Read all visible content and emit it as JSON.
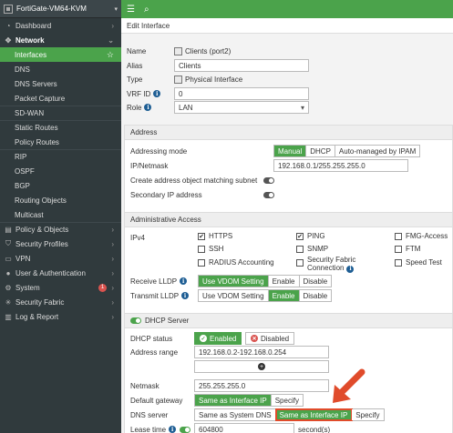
{
  "header": {
    "device_title": "FortiGate-VM64-KVM"
  },
  "sidebar": {
    "items": [
      {
        "label": "Dashboard",
        "icon": "dashboard-icon"
      },
      {
        "label": "Network",
        "icon": "network-icon"
      },
      {
        "label": "Interfaces"
      },
      {
        "label": "DNS"
      },
      {
        "label": "DNS Servers"
      },
      {
        "label": "Packet Capture"
      },
      {
        "label": "SD-WAN"
      },
      {
        "label": "Static Routes"
      },
      {
        "label": "Policy Routes"
      },
      {
        "label": "RIP"
      },
      {
        "label": "OSPF"
      },
      {
        "label": "BGP"
      },
      {
        "label": "Routing Objects"
      },
      {
        "label": "Multicast"
      },
      {
        "label": "Policy & Objects",
        "icon": "policy-icon"
      },
      {
        "label": "Security Profiles",
        "icon": "shield-icon"
      },
      {
        "label": "VPN",
        "icon": "vpn-icon"
      },
      {
        "label": "User & Authentication",
        "icon": "user-icon"
      },
      {
        "label": "System",
        "icon": "gear-icon",
        "badge": "1"
      },
      {
        "label": "Security Fabric",
        "icon": "fabric-icon"
      },
      {
        "label": "Log & Report",
        "icon": "chart-icon"
      }
    ]
  },
  "page": {
    "title": "Edit Interface"
  },
  "form": {
    "name_label": "Name",
    "name_value": "Clients (port2)",
    "alias_label": "Alias",
    "alias_value": "Clients",
    "type_label": "Type",
    "type_value": "Physical Interface",
    "vrf_label": "VRF ID",
    "vrf_value": "0",
    "role_label": "Role",
    "role_value": "LAN"
  },
  "address": {
    "header": "Address",
    "mode_label": "Addressing mode",
    "mode_options": [
      "Manual",
      "DHCP",
      "Auto-managed by IPAM"
    ],
    "ip_label": "IP/Netmask",
    "ip_value": "192.168.0.1/255.255.255.0",
    "create_obj_label": "Create address object matching subnet",
    "secondary_label": "Secondary IP address"
  },
  "admin": {
    "header": "Administrative Access",
    "ipv4_label": "IPv4",
    "https": "HTTPS",
    "ping": "PING",
    "fmg": "FMG-Access",
    "ssh": "SSH",
    "snmp": "SNMP",
    "ftm": "FTM",
    "radius": "RADIUS Accounting",
    "fabric_line1": "Security Fabric",
    "fabric_line2": "Connection",
    "speed": "Speed Test",
    "recv_lldp_label": "Receive LLDP",
    "trans_lldp_label": "Transmit LLDP",
    "lldp_options": [
      "Use VDOM Setting",
      "Enable",
      "Disable"
    ]
  },
  "dhcp": {
    "header": "DHCP Server",
    "status_label": "DHCP status",
    "enabled": "Enabled",
    "disabled": "Disabled",
    "range_label": "Address range",
    "range_value": "192.168.0.2-192.168.0.254",
    "netmask_label": "Netmask",
    "netmask_value": "255.255.255.0",
    "gateway_label": "Default gateway",
    "gateway_options": [
      "Same as Interface IP",
      "Specify"
    ],
    "dns_label": "DNS server",
    "dns_options": [
      "Same as System DNS",
      "Same as Interface IP",
      "Specify"
    ],
    "lease_label": "Lease time",
    "lease_value": "604800",
    "lease_unit": "second(s)"
  },
  "colors": {
    "accent": "#4ba34b",
    "sidebar": "#303a3d",
    "highlight": "#e04b2b"
  }
}
